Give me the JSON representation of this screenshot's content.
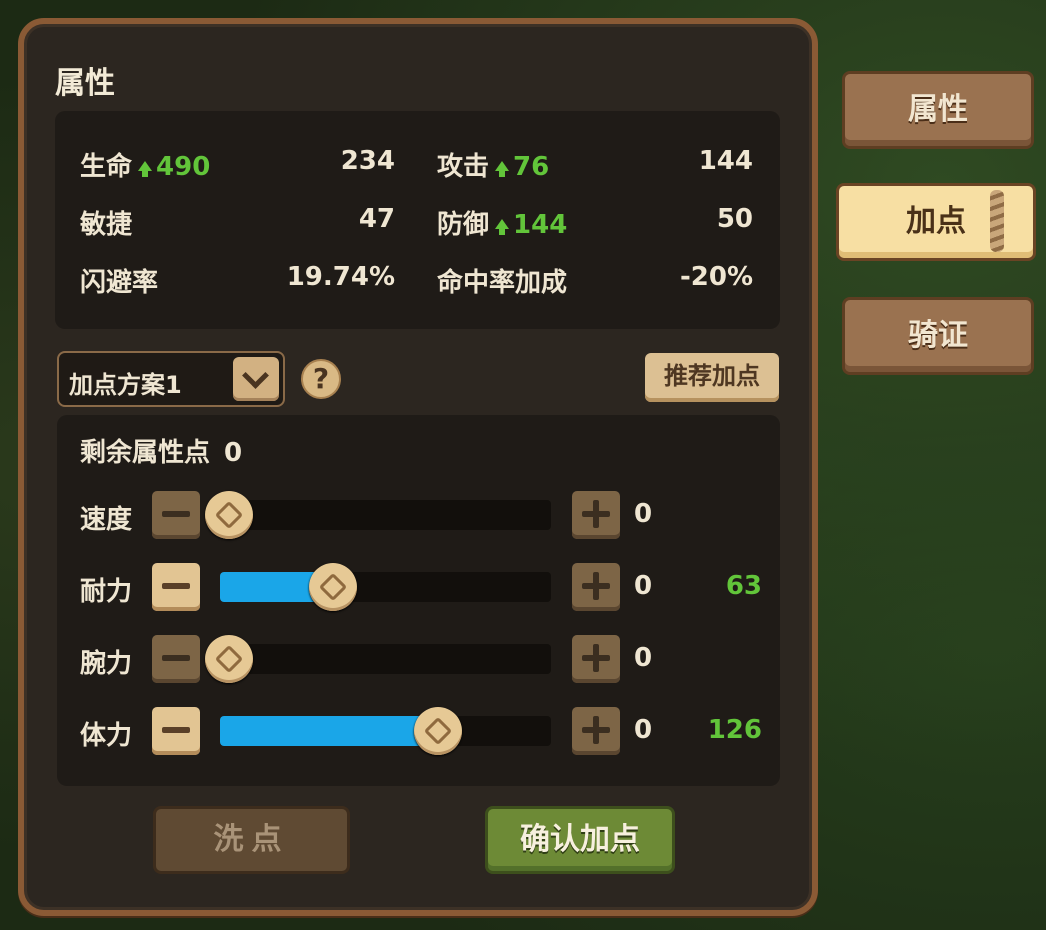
{
  "panel": {
    "title": "属性"
  },
  "stats": [
    {
      "label": "生命",
      "bonus": "490",
      "value": "234"
    },
    {
      "label": "攻击",
      "bonus": "76",
      "value": "144"
    },
    {
      "label": "敏捷",
      "bonus": "",
      "value": "47"
    },
    {
      "label": "防御",
      "bonus": "144",
      "value": "50"
    },
    {
      "label": "闪避率",
      "bonus": "",
      "value": "19.74%"
    },
    {
      "label": "命中率加成",
      "bonus": "",
      "value": "-20%"
    }
  ],
  "scheme": {
    "selected": "加点方案1"
  },
  "help_icon": "?",
  "recommend_label": "推荐加点",
  "remaining": {
    "label": "剩余属性点",
    "value": "0"
  },
  "attributes": [
    {
      "label": "速度",
      "allocated": "0",
      "bonus": "",
      "level": 0
    },
    {
      "label": "耐力",
      "allocated": "0",
      "bonus": "63",
      "level": 0.34
    },
    {
      "label": "腕力",
      "allocated": "0",
      "bonus": "",
      "level": 0
    },
    {
      "label": "体力",
      "allocated": "0",
      "bonus": "126",
      "level": 0.66
    }
  ],
  "buttons": {
    "reset": "洗点",
    "confirm": "确认加点"
  },
  "tabs": [
    {
      "label": "属性",
      "active": false
    },
    {
      "label": "加点",
      "active": true
    },
    {
      "label": "骑证",
      "active": false
    }
  ],
  "colors": {
    "accent_green": "#62c53a",
    "slider_blue": "#1aa6e8",
    "frame_brown": "#8a5a35"
  }
}
